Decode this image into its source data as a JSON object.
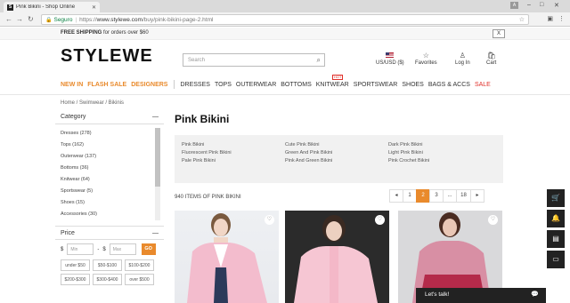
{
  "browser": {
    "tab_title": "Pink Bikini - Shop Online",
    "tab_favicon": "S",
    "user_badge": "A",
    "secure_label": "Seguro",
    "url_scheme": "https://",
    "url_host": "www.stylewe.com",
    "url_path": "/buy/pink-bikini-page-2.html"
  },
  "promo": {
    "bold": "FREE SHIPPING",
    "text": " for orders over $60",
    "close": "X"
  },
  "header": {
    "logo": "STYLEWE",
    "search_placeholder": "Search",
    "currency": "US/USD ($)",
    "favorites": "Favorites",
    "login": "Log In",
    "cart": "Cart"
  },
  "nav": {
    "highlight": [
      "NEW IN",
      "FLASH SALE",
      "DESIGNERS"
    ],
    "items": [
      "DRESSES",
      "TOPS",
      "OUTERWEAR",
      "BOTTOMS",
      "KNITWEAR",
      "SPORTSWEAR",
      "SHOES",
      "BAGS & ACCS",
      "SALE"
    ],
    "hot_badge": "HOT"
  },
  "breadcrumb": "Home  /  Swimwear  /  Bikinis",
  "sidebar": {
    "category_title": "Category",
    "collapse": "—",
    "categories": [
      "Dresses (278)",
      "Tops (162)",
      "Outerwear (137)",
      "Bottoms (36)",
      "Knitwear (64)",
      "Sportswear (5)",
      "Shoes (15)",
      "Accessories (30)"
    ],
    "price_title": "Price",
    "currency_symbol": "$",
    "min_placeholder": "Min",
    "max_placeholder": "Max",
    "dash": "-",
    "go": "GO",
    "ranges": [
      "under $50",
      "$50-$100",
      "$100-$200",
      "$200-$300",
      "$300-$400",
      "over $500"
    ]
  },
  "content": {
    "title": "Pink Bikini",
    "related": [
      "Pink Bikini",
      "Cute Pink Bikini",
      "Dark Pink Bikini",
      "Fluorescent Pink Bikini",
      "Green And Pink Bikini",
      "Light Pink Bikini",
      "Pale Pink Bikini",
      "Pink And Green Bikini",
      "Pink Crochet Bikini"
    ],
    "count": "940 ITEMS OF PINK BIKINI",
    "pager": [
      "◂",
      "1",
      "2",
      "3",
      "...",
      "18",
      "▸"
    ],
    "current_page": "2"
  },
  "chat": {
    "label": "Let's talk!"
  }
}
